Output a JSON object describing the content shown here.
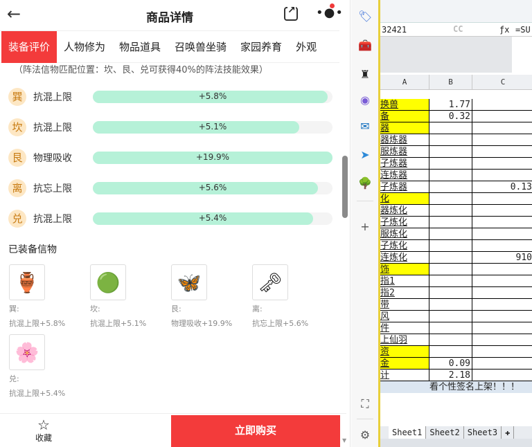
{
  "header": {
    "title": "商品详情"
  },
  "tabs": [
    "装备评价",
    "人物修为",
    "物品道具",
    "召唤兽坐骑",
    "家园养育",
    "外观"
  ],
  "note": "（阵法信物匹配位置：坎、艮、兑可获得40%的阵法技能效果）",
  "stats": [
    {
      "pos": "巽",
      "name": "抗混上限",
      "value": "+5.8%",
      "fill": 0.98
    },
    {
      "pos": "坎",
      "name": "抗混上限",
      "value": "+5.1%",
      "fill": 0.86
    },
    {
      "pos": "艮",
      "name": "物理吸收",
      "value": "+19.9%",
      "fill": 1.0
    },
    {
      "pos": "离",
      "name": "抗忘上限",
      "value": "+5.6%",
      "fill": 0.94
    },
    {
      "pos": "兑",
      "name": "抗混上限",
      "value": "+5.4%",
      "fill": 0.92
    }
  ],
  "equipped": {
    "heading": "已装备信物",
    "items": [
      {
        "pos": "巽:",
        "effect": "抗混上限+5.8%",
        "icon": "🏺"
      },
      {
        "pos": "坎:",
        "effect": "抗混上限+5.1%",
        "icon": "🟢"
      },
      {
        "pos": "艮:",
        "effect": "物理吸收+19.9%",
        "icon": "🦋"
      },
      {
        "pos": "离:",
        "effect": "抗忘上限+5.6%",
        "icon": "🗝"
      },
      {
        "pos": "兑:",
        "effect": "抗混上限+5.4%",
        "icon": "🌸"
      }
    ]
  },
  "footer": {
    "favorite": "收藏",
    "buy": "立即购买"
  },
  "excel": {
    "namebox": "32421",
    "formula": "=SU",
    "watermark": "CC",
    "cols": [
      "A",
      "B",
      "C"
    ],
    "rows": [
      {
        "a": "换兽",
        "b": "1.77",
        "c": "",
        "y": true
      },
      {
        "a": "备",
        "b": "0.32",
        "c": "",
        "y": true
      },
      {
        "a": "器",
        "b": "",
        "c": "",
        "y": true
      },
      {
        "a": "器炼器",
        "b": "",
        "c": ""
      },
      {
        "a": "服炼器",
        "b": "",
        "c": ""
      },
      {
        "a": "子炼器",
        "b": "",
        "c": ""
      },
      {
        "a": "连炼器",
        "b": "",
        "c": ""
      },
      {
        "a": "子炼器",
        "b": "",
        "c": "0.13"
      },
      {
        "a": "化",
        "b": "",
        "c": "",
        "y": true
      },
      {
        "a": "器炼化",
        "b": "",
        "c": ""
      },
      {
        "a": "子炼化",
        "b": "",
        "c": ""
      },
      {
        "a": "服炼化",
        "b": "",
        "c": ""
      },
      {
        "a": "子炼化",
        "b": "",
        "c": ""
      },
      {
        "a": "连炼化",
        "b": "",
        "c": "910"
      },
      {
        "a": "饰",
        "b": "",
        "c": "",
        "y": true
      },
      {
        "a": "指1",
        "b": "",
        "c": ""
      },
      {
        "a": "指2",
        "b": "",
        "c": ""
      },
      {
        "a": "带",
        "b": "",
        "c": ""
      },
      {
        "a": "风",
        "b": "",
        "c": ""
      },
      {
        "a": "件",
        "b": "",
        "c": ""
      },
      {
        "a": "上仙羽",
        "b": "",
        "c": ""
      },
      {
        "a": "资",
        "b": "",
        "c": "",
        "y": true
      },
      {
        "a": "金",
        "b": "0.09",
        "c": "",
        "y": true
      },
      {
        "a": "计",
        "b": "2.18",
        "c": ""
      },
      {
        "a": "",
        "b": "",
        "c": ""
      }
    ],
    "banner": "看个性签名上架！！！",
    "sheets": [
      "Sheet1",
      "Sheet2",
      "Sheet3"
    ]
  }
}
